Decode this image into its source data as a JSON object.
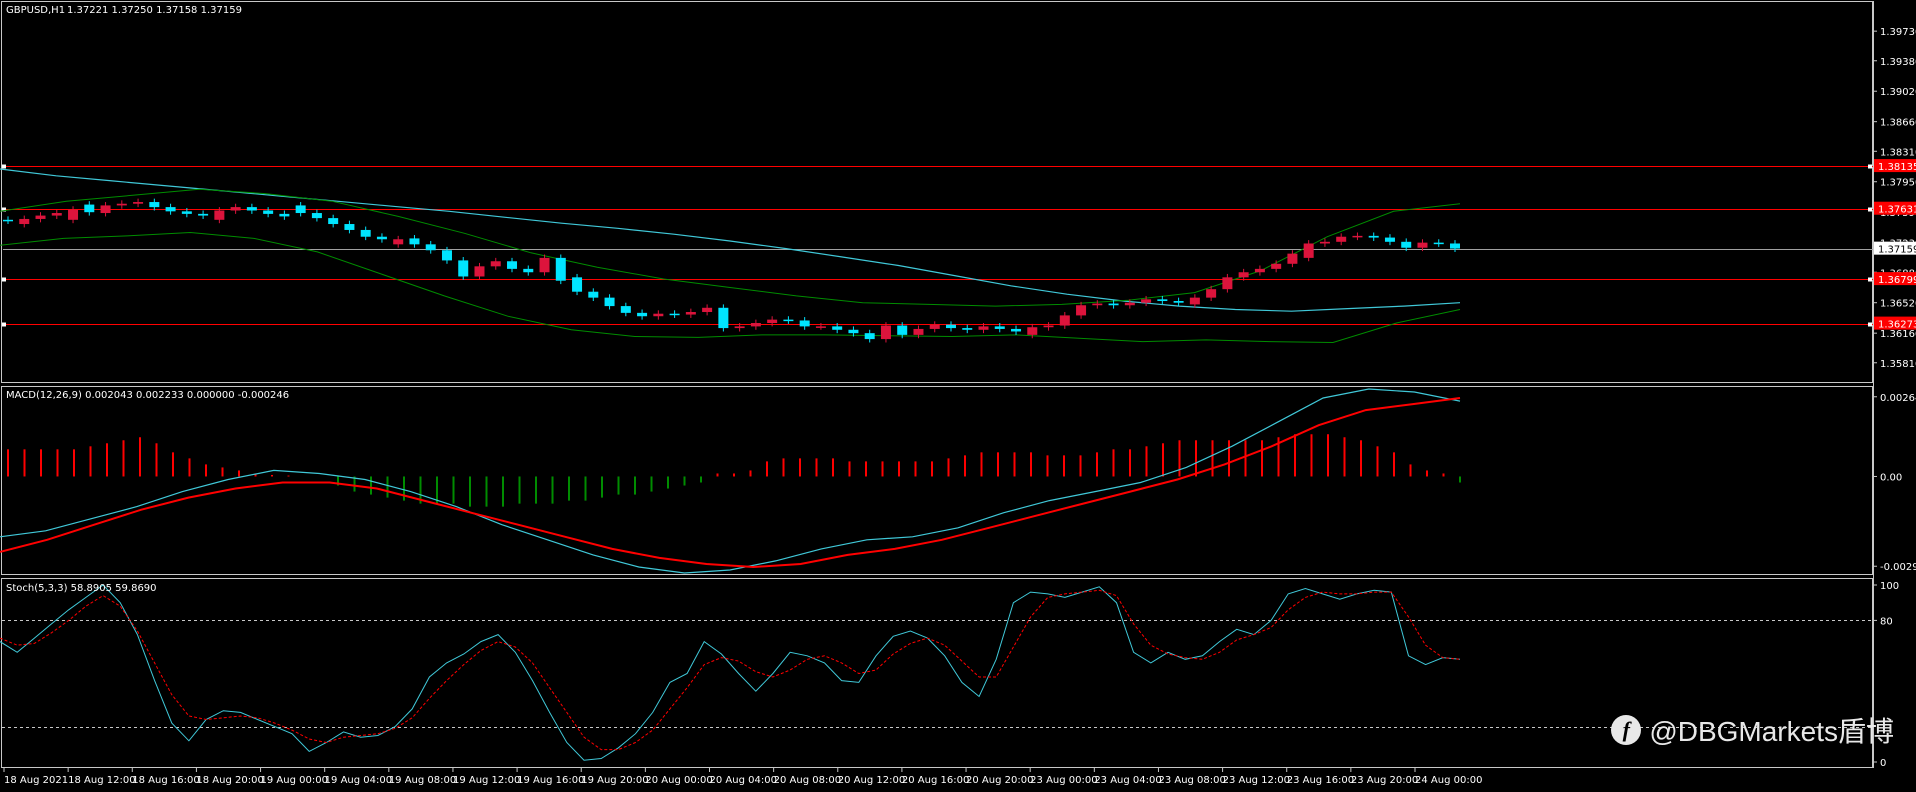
{
  "colors": {
    "background": "#000000",
    "frame": "#c8c8c8",
    "text": "#ffffff",
    "bull": "#dc143c",
    "bear": "#00e5ff",
    "sr_line": "#ff0000",
    "ma_line": "#40c8d8",
    "band_line": "#008c00",
    "macd_hist_pos": "#ff0000",
    "macd_hist_neg": "#008c00",
    "macd_main": "#40c8d8",
    "macd_signal": "#ff0000",
    "stoch_main": "#40c8d8",
    "stoch_signal": "#ff0000",
    "level_line": "#c8c8c8"
  },
  "header": {
    "symbol": "GBPUSD,H1",
    "ohlc": "1.37221 1.37250 1.37158 1.37159"
  },
  "watermark": {
    "text": "@DBGMarkets盾博",
    "logo_icon": "dbg-logo-icon"
  },
  "chart_data": [
    {
      "type": "candlestick",
      "title": "GBPUSD,H1",
      "ylim": [
        1.3563,
        1.3998
      ],
      "yticks": [
        "1.39730",
        "1.39380",
        "1.39020",
        "1.38660",
        "1.38310",
        "1.37950",
        "1.37590",
        "1.37230",
        "1.36880",
        "1.36520",
        "1.36160",
        "1.35810"
      ],
      "xticks": [
        "18 Aug 2021",
        "18 Aug 12:00",
        "18 Aug 16:00",
        "18 Aug 20:00",
        "19 Aug 00:00",
        "19 Aug 04:00",
        "19 Aug 08:00",
        "19 Aug 12:00",
        "19 Aug 16:00",
        "19 Aug 20:00",
        "20 Aug 00:00",
        "20 Aug 04:00",
        "20 Aug 08:00",
        "20 Aug 12:00",
        "20 Aug 16:00",
        "20 Aug 20:00",
        "23 Aug 00:00",
        "23 Aug 04:00",
        "23 Aug 08:00",
        "23 Aug 12:00",
        "23 Aug 16:00",
        "23 Aug 20:00",
        "24 Aug 00:00"
      ],
      "horizontal_levels": [
        {
          "value": 1.38135,
          "label": "1.38135",
          "labeled": true
        },
        {
          "value": 1.37631,
          "label": "1.37631",
          "labeled": true
        },
        {
          "value": 1.37159,
          "label": "1.37159",
          "labeled": true,
          "current_price": true
        },
        {
          "value": 1.36799,
          "label": "1.36799",
          "labeled": true
        },
        {
          "value": 1.36273,
          "label": "1.36273",
          "labeled": true
        }
      ],
      "close": [
        1.3749,
        1.3751,
        1.3755,
        1.3758,
        1.3762,
        1.3759,
        1.3767,
        1.3769,
        1.3771,
        1.3765,
        1.376,
        1.3757,
        1.3755,
        1.3761,
        1.3765,
        1.3761,
        1.3757,
        1.3754,
        1.3758,
        1.3752,
        1.3745,
        1.3738,
        1.373,
        1.3727,
        1.3727,
        1.3721,
        1.3714,
        1.3702,
        1.3683,
        1.3695,
        1.3701,
        1.3692,
        1.3688,
        1.3705,
        1.3678,
        1.3665,
        1.3658,
        1.3648,
        1.364,
        1.3636,
        1.3639,
        1.3638,
        1.3641,
        1.3646,
        1.3622,
        1.3624,
        1.3628,
        1.3632,
        1.3631,
        1.3624,
        1.3624,
        1.362,
        1.3616,
        1.3609,
        1.3625,
        1.3614,
        1.3621,
        1.3626,
        1.3622,
        1.362,
        1.3624,
        1.3621,
        1.3618,
        1.3623,
        1.3625,
        1.3637,
        1.3649,
        1.3651,
        1.3649,
        1.3652,
        1.3656,
        1.3654,
        1.3652,
        1.3658,
        1.3668,
        1.3682,
        1.3688,
        1.3692,
        1.3698,
        1.371,
        1.3722,
        1.3724,
        1.373,
        1.3731,
        1.3729,
        1.3724,
        1.3717,
        1.3723,
        1.3722,
        1.3716
      ],
      "open": [
        1.375,
        1.3745,
        1.3751,
        1.3755,
        1.375,
        1.3768,
        1.3758,
        1.3767,
        1.3769,
        1.3771,
        1.3765,
        1.376,
        1.3757,
        1.375,
        1.3761,
        1.3765,
        1.3761,
        1.3757,
        1.3767,
        1.3758,
        1.3752,
        1.3745,
        1.3738,
        1.373,
        1.3721,
        1.3728,
        1.3721,
        1.3714,
        1.3702,
        1.3683,
        1.3695,
        1.3701,
        1.3692,
        1.3688,
        1.3705,
        1.3682,
        1.3665,
        1.3658,
        1.3648,
        1.364,
        1.3636,
        1.3639,
        1.3638,
        1.3641,
        1.3646,
        1.3622,
        1.3624,
        1.3628,
        1.3632,
        1.3631,
        1.3624,
        1.3624,
        1.362,
        1.3616,
        1.3609,
        1.3625,
        1.3614,
        1.3621,
        1.3626,
        1.3622,
        1.362,
        1.3624,
        1.3621,
        1.3614,
        1.3623,
        1.3625,
        1.3637,
        1.3649,
        1.3651,
        1.3649,
        1.3652,
        1.3656,
        1.3654,
        1.365,
        1.3658,
        1.3668,
        1.3682,
        1.3688,
        1.3692,
        1.3698,
        1.3705,
        1.3722,
        1.3724,
        1.373,
        1.3731,
        1.3729,
        1.3724,
        1.3717,
        1.3723,
        1.3722
      ],
      "ma": [
        1.381,
        1.3802,
        1.3796,
        1.379,
        1.3784,
        1.3778,
        1.3772,
        1.3766,
        1.376,
        1.3753,
        1.3746,
        1.374,
        1.3733,
        1.3725,
        1.3716,
        1.3706,
        1.3696,
        1.3684,
        1.3672,
        1.3662,
        1.3654,
        1.3648,
        1.3644,
        1.3642,
        1.3645,
        1.3648,
        1.3652
      ],
      "band_upper": [
        1.376,
        1.3772,
        1.3779,
        1.3786,
        1.3781,
        1.3772,
        1.3754,
        1.3734,
        1.3711,
        1.3694,
        1.368,
        1.367,
        1.366,
        1.3652,
        1.365,
        1.3648,
        1.365,
        1.3655,
        1.3664,
        1.369,
        1.373,
        1.376,
        1.3769
      ],
      "band_lower": [
        1.372,
        1.3728,
        1.3731,
        1.3735,
        1.3728,
        1.3712,
        1.3686,
        1.366,
        1.3636,
        1.362,
        1.3612,
        1.3611,
        1.3614,
        1.3614,
        1.3613,
        1.3612,
        1.3614,
        1.361,
        1.3606,
        1.3608,
        1.3606,
        1.3605,
        1.3628,
        1.3644
      ]
    },
    {
      "type": "bar",
      "title": "MACD(12,26,9) 0.002043 0.002233 0.000000 -0.000246",
      "ylim": [
        -0.0031,
        0.0028
      ],
      "yticks": [
        "0.002642",
        "0.00",
        "-0.002975"
      ],
      "histogram": [
        0.0009,
        0.0009,
        0.0009,
        0.0009,
        0.0009,
        0.001,
        0.0011,
        0.0012,
        0.0013,
        0.0011,
        0.0008,
        0.0006,
        0.0004,
        0.0003,
        0.0002,
        0.0001,
        5e-05,
        3e-05,
        0.0,
        0.0,
        -0.0003,
        -0.0005,
        -0.0006,
        -0.0007,
        -0.0008,
        -0.0009,
        -0.0009,
        -0.0009,
        -0.001,
        -0.001,
        -0.001,
        -0.0009,
        -0.0009,
        -0.0009,
        -0.0008,
        -0.0008,
        -0.0007,
        -0.0006,
        -0.0006,
        -0.0005,
        -0.0004,
        -0.0003,
        -0.0002,
        0.0001,
        0.0001,
        0.0002,
        0.0005,
        0.0006,
        0.0006,
        0.0006,
        0.0006,
        0.0005,
        0.0005,
        0.0005,
        0.0005,
        0.0005,
        0.0005,
        0.0006,
        0.0007,
        0.0008,
        0.0008,
        0.0008,
        0.0008,
        0.0007,
        0.0007,
        0.0007,
        0.0008,
        0.0009,
        0.0009,
        0.001,
        0.0011,
        0.0012,
        0.0012,
        0.0012,
        0.0012,
        0.0012,
        0.0012,
        0.0013,
        0.0014,
        0.0014,
        0.0014,
        0.0013,
        0.0012,
        0.001,
        0.0008,
        0.0004,
        0.0002,
        0.0001,
        -0.0002
      ],
      "macd": [
        -0.002,
        -0.0018,
        -0.0014,
        -0.001,
        -0.0005,
        -0.0001,
        0.0002,
        0.0001,
        -0.0001,
        -0.0005,
        -0.001,
        -0.0016,
        -0.0021,
        -0.0026,
        -0.003,
        -0.0032,
        -0.0031,
        -0.0028,
        -0.0024,
        -0.0021,
        -0.002,
        -0.0017,
        -0.0012,
        -0.0008,
        -0.0005,
        -0.0002,
        0.0003,
        0.001,
        0.0018,
        0.0026,
        0.0029,
        0.0028,
        0.0025
      ],
      "signal": [
        -0.0025,
        -0.0021,
        -0.0016,
        -0.0011,
        -0.0007,
        -0.0004,
        -0.0002,
        -0.0002,
        -0.0004,
        -0.0008,
        -0.0012,
        -0.0016,
        -0.002,
        -0.0024,
        -0.0027,
        -0.0029,
        -0.003,
        -0.0029,
        -0.0026,
        -0.0024,
        -0.0021,
        -0.0017,
        -0.0013,
        -0.0009,
        -0.0005,
        -0.0001,
        0.0004,
        0.001,
        0.0017,
        0.0022,
        0.0024,
        0.0026
      ]
    },
    {
      "type": "line",
      "title": "Stoch(5,3,3) 58.8905 59.8690",
      "ylim": [
        0,
        100
      ],
      "yticks": [
        "100",
        "80",
        "0"
      ],
      "levels": [
        80,
        20
      ],
      "main": [
        68,
        62,
        70,
        78,
        86,
        93,
        100,
        90,
        72,
        46,
        22,
        12,
        24,
        29,
        28,
        24,
        20,
        16,
        6,
        11,
        17,
        14,
        15,
        20,
        30,
        48,
        56,
        61,
        68,
        72,
        62,
        46,
        28,
        11,
        1,
        2,
        8,
        16,
        28,
        45,
        50,
        68,
        61,
        50,
        40,
        50,
        62,
        60,
        56,
        46,
        45,
        60,
        71,
        74,
        70,
        60,
        45,
        37,
        58,
        90,
        96,
        95,
        93,
        96,
        99,
        90,
        62,
        56,
        62,
        58,
        60,
        68,
        75,
        72,
        80,
        95,
        98,
        95,
        92,
        95,
        97,
        96,
        60,
        55,
        59,
        58
      ],
      "signal": [
        70,
        66,
        67,
        73,
        80,
        88,
        94,
        88,
        74,
        56,
        38,
        26,
        24,
        25,
        26,
        25,
        22,
        18,
        13,
        11,
        14,
        15,
        16,
        19,
        25,
        36,
        46,
        55,
        63,
        68,
        65,
        56,
        42,
        28,
        14,
        7,
        7,
        11,
        18,
        30,
        42,
        55,
        59,
        57,
        51,
        48,
        52,
        58,
        60,
        56,
        50,
        52,
        61,
        67,
        70,
        66,
        57,
        48,
        48,
        65,
        82,
        93,
        95,
        96,
        97,
        94,
        78,
        66,
        61,
        59,
        58,
        62,
        69,
        72,
        76,
        86,
        93,
        96,
        95,
        95,
        96,
        96,
        82,
        66,
        59,
        58
      ]
    }
  ]
}
